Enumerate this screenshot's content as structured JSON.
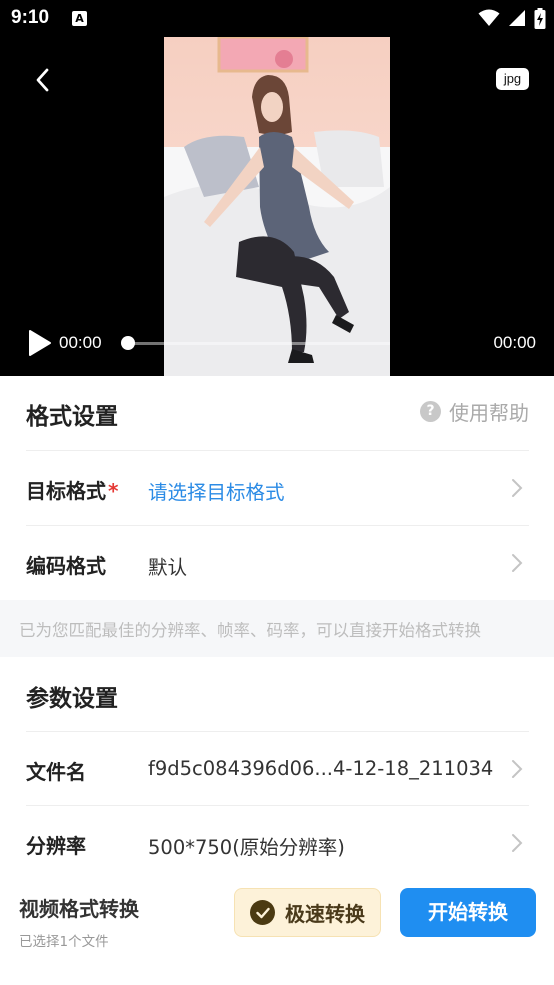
{
  "status_bar": {
    "time": "9:10",
    "notification_icon": "a-letter-icon",
    "icons": [
      "wifi-icon",
      "cellular-signal-icon",
      "battery-charging-icon"
    ]
  },
  "player": {
    "format_badge": "jpg",
    "current_time": "00:00",
    "total_time": "00:00",
    "progress": 0
  },
  "format_settings": {
    "title": "格式设置",
    "help_label": "使用帮助",
    "rows": [
      {
        "label": "目标格式",
        "required_mark": "*",
        "value": "请选择目标格式"
      },
      {
        "label": "编码格式",
        "value": "默认"
      }
    ],
    "tip": "已为您匹配最佳的分辨率、帧率、码率，可以直接开始格式转换"
  },
  "param_settings": {
    "title": "参数设置",
    "rows": [
      {
        "label": "文件名",
        "value": "f9d5c084396d06...4-12-18_211034"
      },
      {
        "label": "分辨率",
        "value": "500*750(原始分辨率)"
      }
    ]
  },
  "bottom_bar": {
    "title": "视频格式转换",
    "subtitle": "已选择1个文件",
    "fast_button": "极速转换",
    "start_button": "开始转换"
  },
  "colors": {
    "accent": "#1f8ef1",
    "link_blue": "#2b8be5",
    "required_red": "#e53935",
    "fast_button_bg": "#fdf2d9"
  }
}
